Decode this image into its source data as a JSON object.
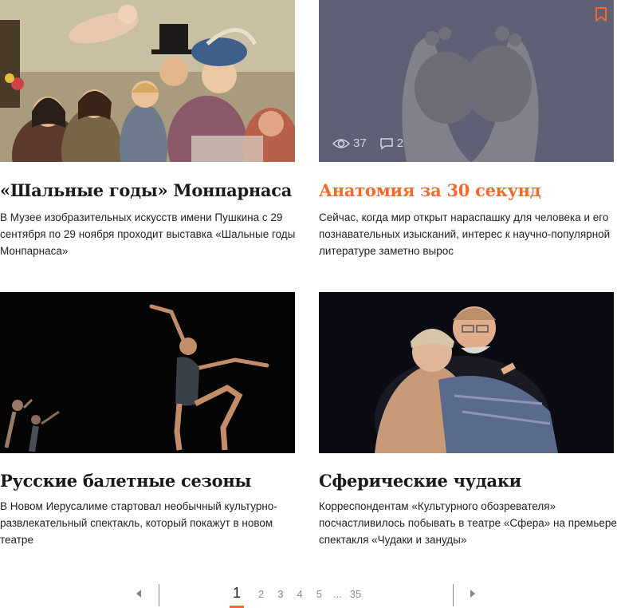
{
  "cards": [
    {
      "title": "«Шальные годы» Монпарнаса",
      "text": "В Музее изобразительных искусств имени Пушкина с 29 сентября по 29 ноября проходит выставка «Шальные годы Монпарнаса»"
    },
    {
      "title": "Анатомия за 30 секунд",
      "text": "Сейчас, когда мир открыт нараспашку для человека и его познавательных изысканий, интерес к научно-популярной литературе заметно вырос",
      "views": "37",
      "comments": "2"
    },
    {
      "title": "Русские балетные сезоны",
      "text": "В Новом Иерусалиме стартовал необычный культурно-развлекательный спектакль, который покажут в новом театре"
    },
    {
      "title": "Сферические чудаки",
      "text": "Корреспондентам «Культурного обозревателя» посчастливилось побывать в театре «Сфера» на премьере спектакля «Чудаки и зануды»"
    }
  ],
  "pagination": {
    "current": "1",
    "pages": [
      "2",
      "3",
      "4",
      "5"
    ],
    "ellipsis": "...",
    "last": "35"
  },
  "colors": {
    "accent": "#f26b2e"
  }
}
